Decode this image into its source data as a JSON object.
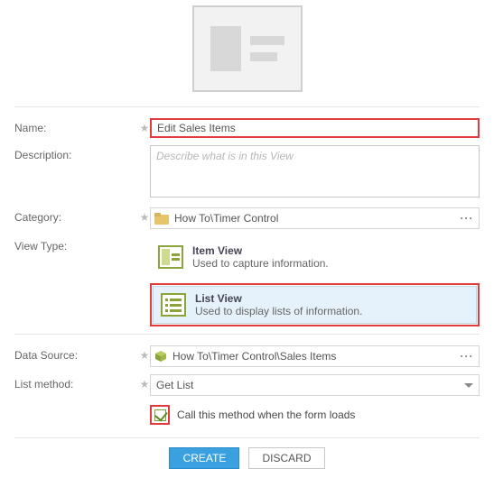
{
  "thumbnail_icon": "document-lines-icon",
  "fields": {
    "name": {
      "label": "Name:",
      "value": "Edit Sales Items"
    },
    "description": {
      "label": "Description:",
      "placeholder": "Describe what is in this View"
    },
    "category": {
      "label": "Category:",
      "value": "How To\\Timer Control",
      "icon": "folder-icon"
    },
    "view_type": {
      "label": "View Type:",
      "options": [
        {
          "id": "item-view",
          "title": "Item View",
          "subtitle": "Used to capture information.",
          "selected": false
        },
        {
          "id": "list-view",
          "title": "List View",
          "subtitle": "Used to display lists of information.",
          "selected": true
        }
      ]
    },
    "data_source": {
      "label": "Data Source:",
      "value": "How To\\Timer Control\\Sales Items",
      "icon": "cube-icon"
    },
    "list_method": {
      "label": "List method:",
      "value": "Get List"
    },
    "call_on_load": {
      "label": "Call this method when the form loads",
      "checked": true
    }
  },
  "buttons": {
    "create": "CREATE",
    "discard": "DISCARD"
  },
  "highlights": {
    "name_input": true,
    "list_view_option": true,
    "call_on_load_checkbox": true,
    "color": "#e23b3b"
  }
}
